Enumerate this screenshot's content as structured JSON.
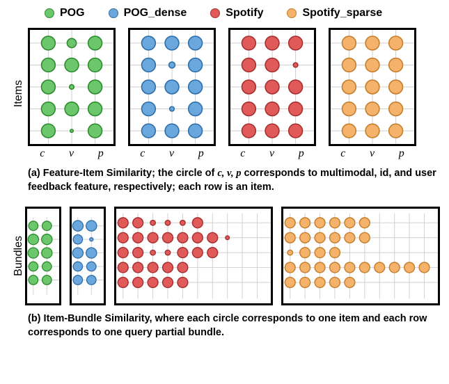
{
  "legend": [
    {
      "label": "POG",
      "color": "#6cc66c",
      "border": "#2e8b2e"
    },
    {
      "label": "POG_dense",
      "color": "#6aa7dd",
      "border": "#2f6ea8"
    },
    {
      "label": "Spotify",
      "color": "#e05a5a",
      "border": "#a63030"
    },
    {
      "label": "Spotify_sparse",
      "color": "#f4b26a",
      "border": "#c47f2e"
    }
  ],
  "ylabels": {
    "a": "Items",
    "b": "Bundles"
  },
  "xticks": [
    "c",
    "v",
    "p"
  ],
  "captions": {
    "a_pre": "(a) Feature-Item Similarity; the circle of ",
    "a_vars": "c, v, p",
    "a_post": " corresponds to multimodal, id, and user feedback feature, respectively; each row is an item.",
    "b": "(b) Item-Bundle Similarity, where each circle corresponds to one item and each row corresponds to one query partial bundle."
  },
  "chart_data": {
    "type": "bubble-grid",
    "note": "radii are relative sizes on a 1–10 scale; rows are items (panel a) or query partial bundles (panel b); panel-b columns are items.",
    "panel_a": {
      "columns": [
        "c",
        "v",
        "p"
      ],
      "series": [
        {
          "name": "POG",
          "radii": [
            [
              9,
              6,
              9
            ],
            [
              9,
              9,
              9
            ],
            [
              9,
              3,
              9
            ],
            [
              9,
              9,
              9
            ],
            [
              9,
              2,
              9
            ]
          ]
        },
        {
          "name": "POG_dense",
          "radii": [
            [
              9,
              9,
              9
            ],
            [
              9,
              4,
              9
            ],
            [
              9,
              9,
              9
            ],
            [
              9,
              3,
              9
            ],
            [
              9,
              9,
              9
            ]
          ]
        },
        {
          "name": "Spotify",
          "radii": [
            [
              9,
              9,
              9
            ],
            [
              9,
              9,
              3
            ],
            [
              9,
              9,
              9
            ],
            [
              9,
              9,
              9
            ],
            [
              9,
              9,
              9
            ]
          ]
        },
        {
          "name": "Spotify_sparse",
          "radii": [
            [
              9,
              9,
              9
            ],
            [
              9,
              9,
              9
            ],
            [
              9,
              9,
              9
            ],
            [
              9,
              9,
              9
            ],
            [
              9,
              9,
              9
            ]
          ]
        }
      ]
    },
    "panel_b": {
      "series": [
        {
          "name": "POG",
          "cols": 2,
          "radii": [
            [
              8,
              8
            ],
            [
              9,
              9
            ],
            [
              9,
              9
            ],
            [
              8,
              8
            ],
            [
              8,
              8
            ]
          ]
        },
        {
          "name": "POG_dense",
          "cols": 2,
          "radii": [
            [
              9,
              9
            ],
            [
              8,
              3
            ],
            [
              9,
              9
            ],
            [
              8,
              8
            ],
            [
              8,
              8
            ]
          ]
        },
        {
          "name": "Spotify",
          "cols": 10,
          "radii": [
            [
              8,
              8,
              4,
              4,
              4,
              8,
              0,
              0,
              0,
              0
            ],
            [
              8,
              8,
              8,
              8,
              8,
              8,
              8,
              3,
              0,
              0
            ],
            [
              8,
              8,
              4,
              4,
              8,
              8,
              8,
              0,
              0,
              0
            ],
            [
              8,
              8,
              8,
              8,
              8,
              0,
              0,
              0,
              0,
              0
            ],
            [
              8,
              8,
              8,
              8,
              8,
              0,
              0,
              0,
              0,
              0
            ]
          ]
        },
        {
          "name": "Spotify_sparse",
          "cols": 10,
          "radii": [
            [
              8,
              8,
              8,
              8,
              8,
              8,
              0,
              0,
              0,
              0
            ],
            [
              8,
              8,
              8,
              8,
              8,
              8,
              0,
              0,
              0,
              0
            ],
            [
              4,
              8,
              8,
              8,
              0,
              0,
              0,
              0,
              0,
              0
            ],
            [
              8,
              8,
              8,
              8,
              8,
              8,
              8,
              8,
              8,
              8
            ],
            [
              8,
              8,
              8,
              8,
              8,
              0,
              0,
              0,
              0,
              0
            ]
          ]
        }
      ]
    }
  }
}
